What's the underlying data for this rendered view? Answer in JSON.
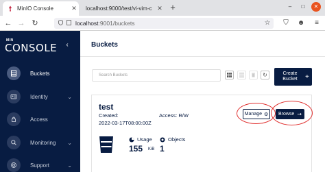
{
  "browser": {
    "tabs": [
      {
        "title": "MinIO Console",
        "active": true
      },
      {
        "title": "localhost:9000/test/vi-vim-c",
        "active": false
      }
    ],
    "new_tab": "+",
    "url_host": "localhost",
    "url_rest": ":9001/buckets"
  },
  "sidebar": {
    "logo_small": "MIN",
    "logo_big": "CONSOLE",
    "items": [
      {
        "label": "Buckets",
        "selected": true,
        "icon": "buckets-icon"
      },
      {
        "label": "Identity",
        "selected": false,
        "icon": "identity-icon",
        "chevron": true
      },
      {
        "label": "Access",
        "selected": false,
        "icon": "access-icon"
      },
      {
        "label": "Monitoring",
        "selected": false,
        "icon": "monitoring-icon",
        "chevron": true
      },
      {
        "label": "Support",
        "selected": false,
        "icon": "support-icon",
        "chevron": true
      }
    ]
  },
  "main": {
    "title": "Buckets",
    "search_placeholder": "Search Buckets",
    "create_label": "Create Bucket",
    "create_plus": "+",
    "bucket": {
      "name": "test",
      "created_label": "Created:",
      "created_value": "2022-03-17T08:00:00Z",
      "access": "Access: R/W",
      "manage_label": "Manage",
      "browse_label": "Browse",
      "usage_label": "Usage",
      "usage_value": "155",
      "usage_unit": "KiB",
      "objects_label": "Objects",
      "objects_value": "1"
    }
  },
  "colors": {
    "navy": "#081c42",
    "annotation": "#e0302f",
    "close_button": "#e95420"
  }
}
